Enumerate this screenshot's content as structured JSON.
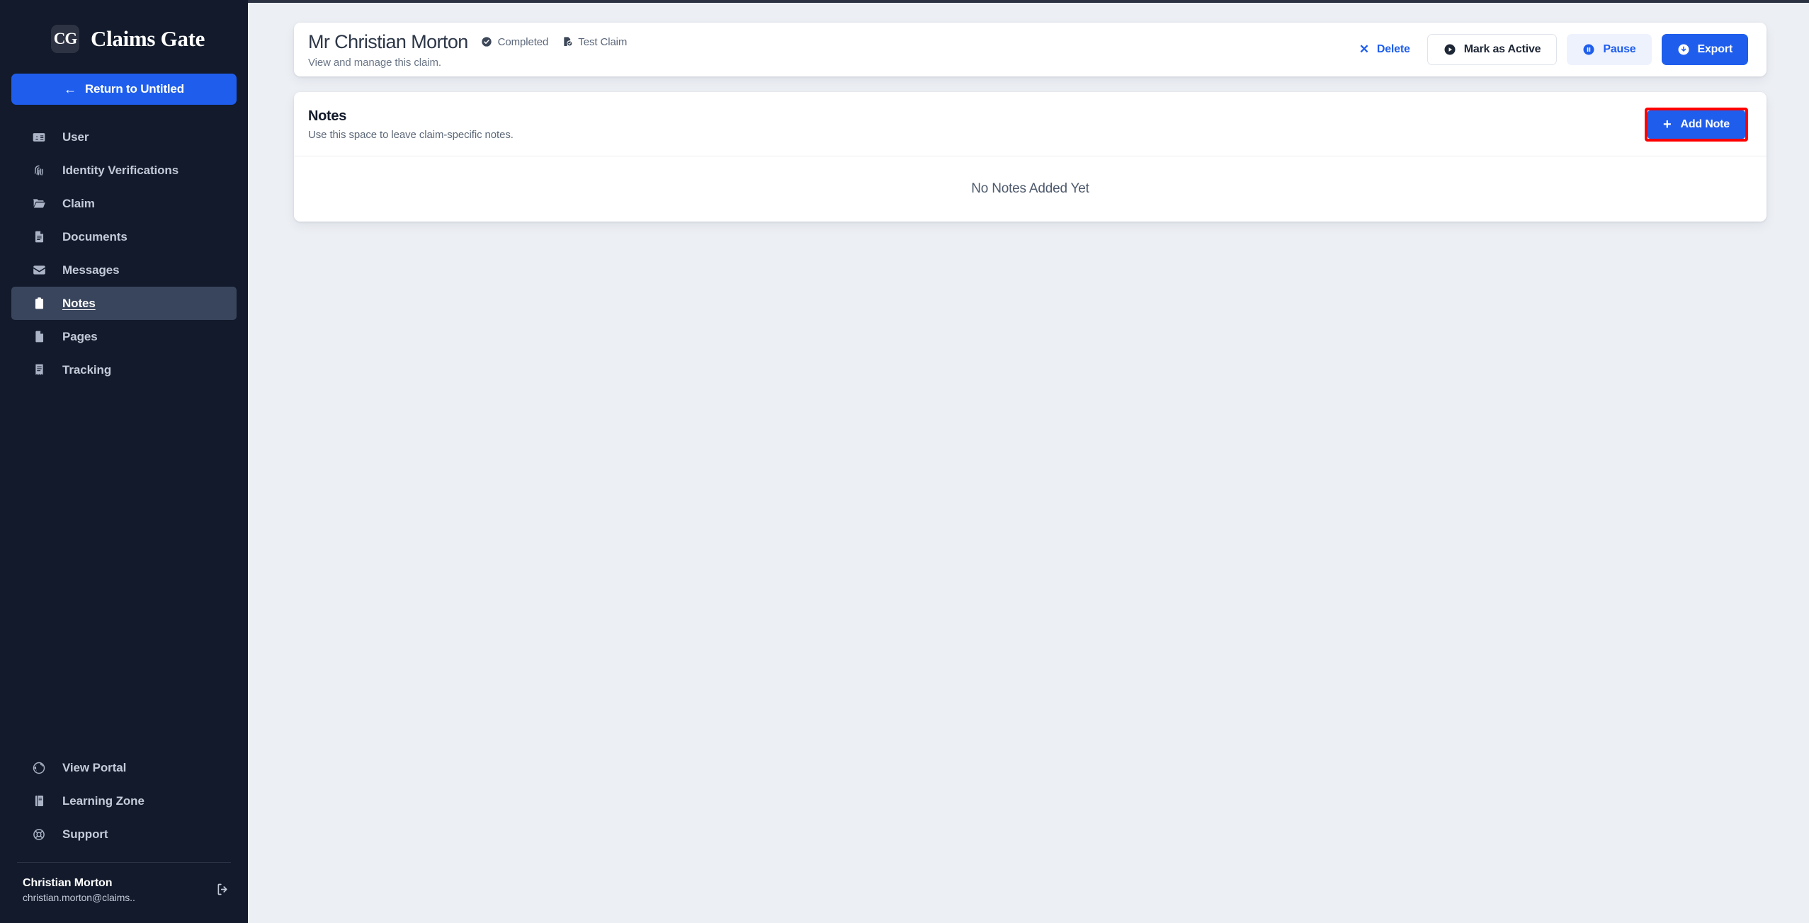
{
  "sidebar": {
    "brand": {
      "mark": "CG",
      "name": "Claims Gate"
    },
    "return_button": {
      "label": "Return to Untitled",
      "icon": "arrow-left-icon"
    },
    "items": [
      {
        "label": "User",
        "icon": "contact-card-icon",
        "active": false
      },
      {
        "label": "Identity Verifications",
        "icon": "fingerprint-icon",
        "active": false
      },
      {
        "label": "Claim",
        "icon": "folder-open-icon",
        "active": false
      },
      {
        "label": "Documents",
        "icon": "document-lines-icon",
        "active": false
      },
      {
        "label": "Messages",
        "icon": "envelope-icon",
        "active": false
      },
      {
        "label": "Notes",
        "icon": "clipboard-icon",
        "active": true
      },
      {
        "label": "Pages",
        "icon": "page-icon",
        "active": false
      },
      {
        "label": "Tracking",
        "icon": "receipt-icon",
        "active": false
      }
    ],
    "bottom_items": [
      {
        "label": "View Portal",
        "icon": "globe-icon"
      },
      {
        "label": "Learning Zone",
        "icon": "book-icon"
      },
      {
        "label": "Support",
        "icon": "lifebuoy-icon"
      }
    ],
    "user": {
      "name": "Christian Morton",
      "email": "christian.morton@claims..",
      "logout_icon": "logout-icon"
    }
  },
  "header": {
    "title": "Mr Christian Morton",
    "subtitle": "View and manage this claim.",
    "badges": [
      {
        "label": "Completed",
        "icon": "check-circle-icon"
      },
      {
        "label": "Test Claim",
        "icon": "file-check-icon"
      }
    ],
    "actions": {
      "delete": {
        "label": "Delete",
        "icon": "close-x-icon"
      },
      "mark_active": {
        "label": "Mark as Active",
        "icon": "play-circle-icon"
      },
      "pause": {
        "label": "Pause",
        "icon": "pause-circle-icon"
      },
      "export": {
        "label": "Export",
        "icon": "download-circle-icon"
      }
    }
  },
  "notes": {
    "title": "Notes",
    "subtitle": "Use this space to leave claim-specific notes.",
    "add_button": {
      "label": "Add Note",
      "icon": "plus-icon"
    },
    "empty_state": "No Notes Added Yet"
  },
  "colors": {
    "sidebar_bg": "#121a2b",
    "sidebar_active": "#39455c",
    "accent_blue": "#1f5eed",
    "soft_blue": "#eef2fd",
    "canvas": "#eceff4",
    "highlight_red": "#ff0000"
  }
}
